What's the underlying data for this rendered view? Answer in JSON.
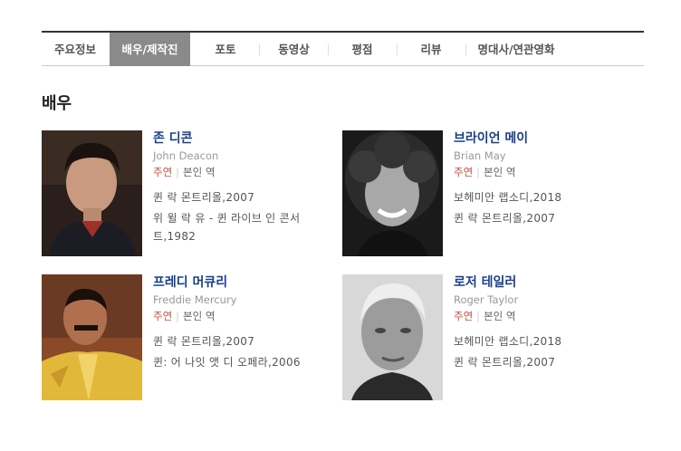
{
  "tabs": [
    {
      "label": "주요정보"
    },
    {
      "label": "배우/제작진"
    },
    {
      "label": "포토"
    },
    {
      "label": "동영상"
    },
    {
      "label": "평점"
    },
    {
      "label": "리뷰"
    },
    {
      "label": "명대사/연관영화"
    }
  ],
  "active_tab": "배우/제작진",
  "section_title": "배우",
  "actors": [
    {
      "name": "존 디콘",
      "english_name": "John Deacon",
      "role_type": "주연",
      "character": "본인 역",
      "films": [
        "퀸 락 몬트리올,2007",
        "위 윌 락 유 - 퀸 라이브 인 콘서트,1982"
      ]
    },
    {
      "name": "브라이언 메이",
      "english_name": "Brian May",
      "role_type": "주연",
      "character": "본인 역",
      "films": [
        "보헤미안 랩소디,2018",
        "퀸 락 몬트리올,2007"
      ]
    },
    {
      "name": "프레디 머큐리",
      "english_name": "Freddie Mercury",
      "role_type": "주연",
      "character": "본인 역",
      "films": [
        "퀸 락 몬트리올,2007",
        "퀸: 어 나잇 앳 디 오페라,2006"
      ]
    },
    {
      "name": "로저 테일러",
      "english_name": "Roger Taylor",
      "role_type": "주연",
      "character": "본인 역",
      "films": [
        "보헤미안 랩소디,2018",
        "퀸 락 몬트리올,2007"
      ]
    }
  ],
  "colors": {
    "name_link": "#1a3f8c",
    "role_type": "#c84b3e",
    "active_tab_bg": "#8a8a8a"
  }
}
